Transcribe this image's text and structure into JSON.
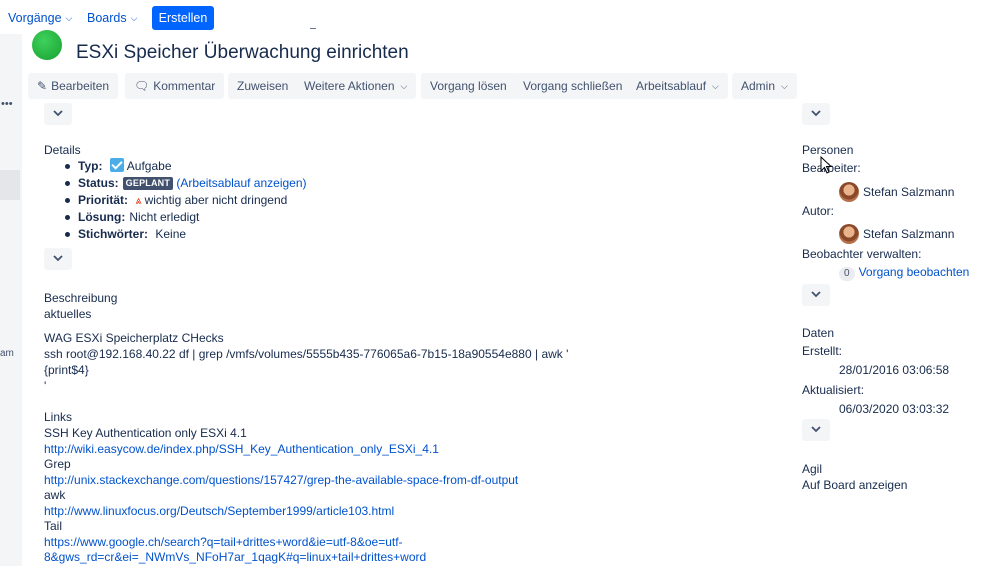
{
  "nav": {
    "vorgaenge": "Vorgänge",
    "boards": "Boards",
    "create": "Erstellen"
  },
  "sidebar": {
    "truncated_text": "am"
  },
  "issue": {
    "title": "ESXi Speicher Überwachung einrichten",
    "status_color": "#36b37e"
  },
  "toolbar": {
    "edit": "Bearbeiten",
    "comment": "Kommentar",
    "assign": "Zuweisen",
    "more_actions": "Weitere Aktionen",
    "resolve": "Vorgang lösen",
    "close": "Vorgang schließen",
    "workflow": "Arbeitsablauf",
    "admin": "Admin"
  },
  "details": {
    "heading": "Details",
    "type_label": "Typ:",
    "type_value": "Aufgabe",
    "status_label": "Status:",
    "status_value": "GEPLANT",
    "status_link": "(Arbeitsablauf anzeigen)",
    "priority_label": "Priorität:",
    "priority_value": "wichtig aber nicht dringend",
    "resolution_label": "Lösung:",
    "resolution_value": "Nicht erledigt",
    "keywords_label": "Stichwörter:",
    "keywords_value": "Keine"
  },
  "description": {
    "heading": "Beschreibung",
    "lines": [
      "aktuelles",
      "WAG ESXi Speicherplatz CHecks",
      "ssh root@192.168.40.22 df | grep /vmfs/volumes/5555b435-776065a6-7b15-18a90554e880 | awk '",
      "{print$4}",
      "'",
      "Links",
      "SSH Key Authentication only ESXi 4.1",
      "Grep",
      "awk",
      "Tail"
    ],
    "links": [
      "http://wiki.easycow.de/index.php/SSH_Key_Authentication_only_ESXi_4.1",
      "http://unix.stackexchange.com/questions/157427/grep-the-available-space-from-df-output",
      "http://www.linuxfocus.org/Deutsch/September1999/article103.html",
      "https://www.google.ch/search?q=tail+drittes+word&ie=utf-8&oe=utf-",
      "8&gws_rd=cr&ei=_NWmVs_NFoH7ar_1qagK#q=linux+tail+drittes+word"
    ]
  },
  "people": {
    "heading": "Personen",
    "assignee_label": "Bearbeiter:",
    "assignee": "Stefan Salzmann",
    "reporter_label": "Autor:",
    "reporter": "Stefan Salzmann",
    "watchers_label": "Beobachter verwalten:",
    "watch_count": "0",
    "watch_link": "Vorgang beobachten"
  },
  "dates": {
    "heading": "Daten",
    "created_label": "Erstellt:",
    "created": "28/01/2016 03:06:58",
    "updated_label": "Aktualisiert:",
    "updated": "06/03/2020 03:03:32"
  },
  "agile": {
    "heading": "Agil",
    "board_link": "Auf Board anzeigen"
  }
}
